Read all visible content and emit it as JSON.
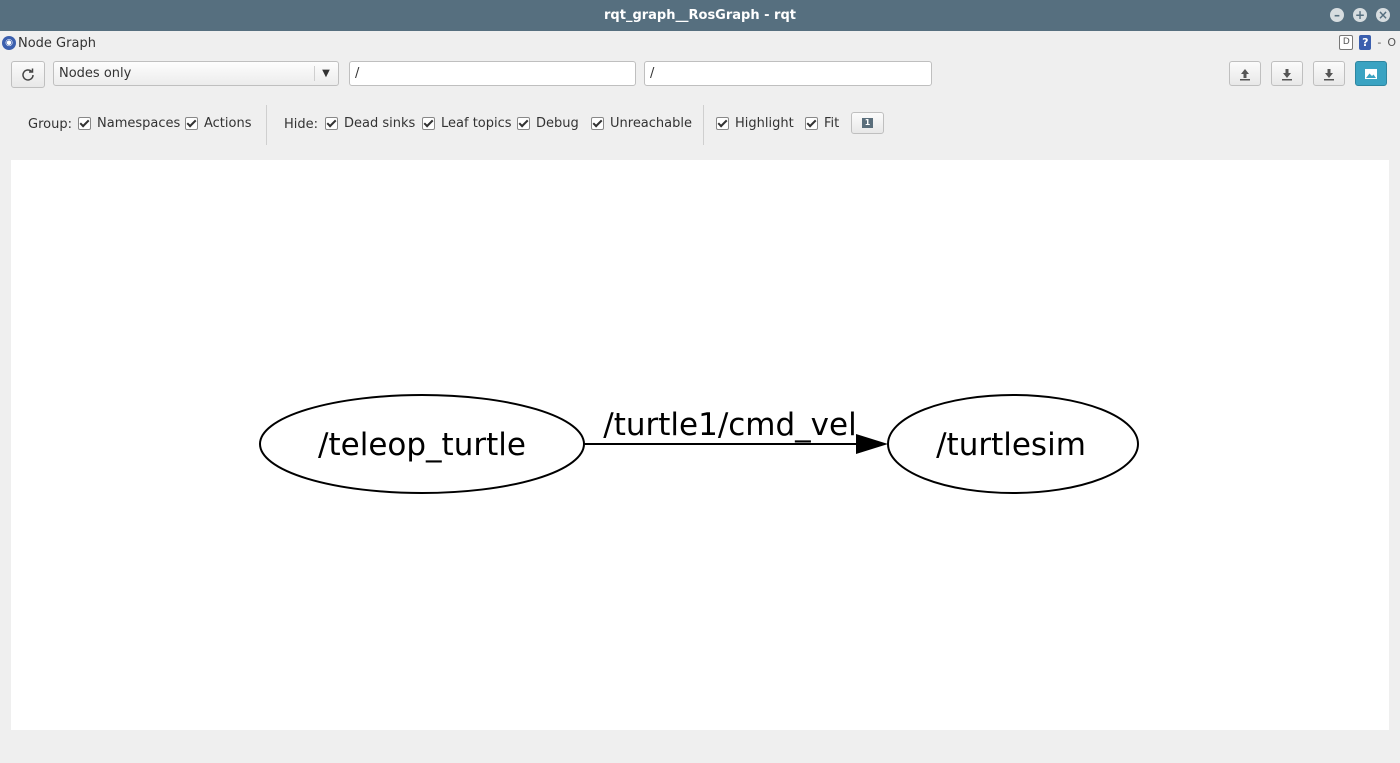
{
  "window": {
    "title": "rqt_graph__RosGraph - rqt"
  },
  "plugin": {
    "title": "Node Graph"
  },
  "toolbar": {
    "mode_selected": "Nodes only",
    "mode_options": [
      "Nodes only"
    ],
    "filter_nodes": "/",
    "filter_topics": "/"
  },
  "options": {
    "group_label": "Group:",
    "namespaces_label": "Namespaces",
    "namespaces_checked": true,
    "actions_label": "Actions",
    "actions_checked": true,
    "hide_label": "Hide:",
    "dead_sinks_label": "Dead sinks",
    "dead_sinks_checked": true,
    "leaf_topics_label": "Leaf topics",
    "leaf_topics_checked": true,
    "debug_label": "Debug",
    "debug_checked": true,
    "unreachable_label": "Unreachable",
    "unreachable_checked": true,
    "highlight_label": "Highlight",
    "highlight_checked": true,
    "fit_label": "Fit",
    "fit_checked": true
  },
  "graph": {
    "nodes": [
      {
        "id": "teleop_turtle",
        "label": "/teleop_turtle"
      },
      {
        "id": "turtlesim",
        "label": "/turtlesim"
      }
    ],
    "edges": [
      {
        "from": "teleop_turtle",
        "to": "turtlesim",
        "label": "/turtle1/cmd_vel"
      }
    ]
  },
  "icons": {
    "window_buttons": [
      "minimize-icon",
      "maximize-icon",
      "close-icon"
    ],
    "toolbar": [
      "refresh-icon",
      "load-dot-icon",
      "save-dot-icon",
      "save-image-icon",
      "save-svg-icon"
    ]
  },
  "colors": {
    "titlebar": "#566f7f",
    "background": "#efefef",
    "canvas": "#ffffff",
    "accent": "#3aa3c2"
  }
}
